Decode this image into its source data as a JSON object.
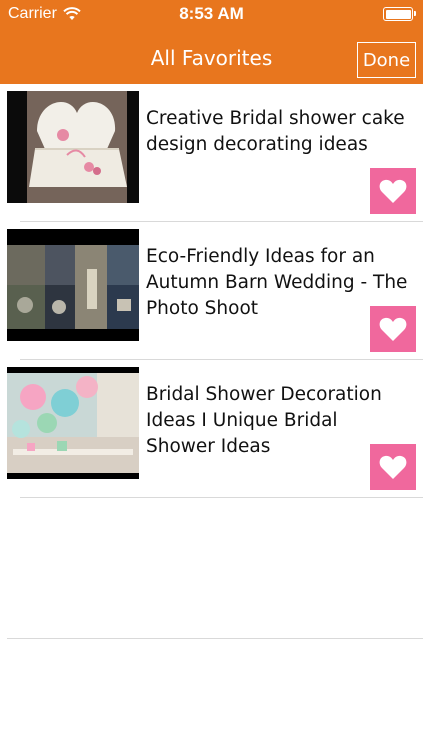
{
  "status_bar": {
    "carrier": "Carrier",
    "time": "8:53 AM"
  },
  "nav": {
    "title": "All Favorites",
    "done_label": "Done"
  },
  "colors": {
    "header": "#e8761e",
    "favorite": "#f0689d"
  },
  "favorites": [
    {
      "title": "Creative Bridal shower cake design decorating ideas",
      "icon": "heart-icon"
    },
    {
      "title": "Eco-Friendly Ideas for an Autumn Barn Wedding - The Photo Shoot",
      "icon": "heart-icon"
    },
    {
      "title": "Bridal Shower Decoration Ideas I Unique Bridal Shower Ideas",
      "icon": "heart-icon"
    }
  ]
}
